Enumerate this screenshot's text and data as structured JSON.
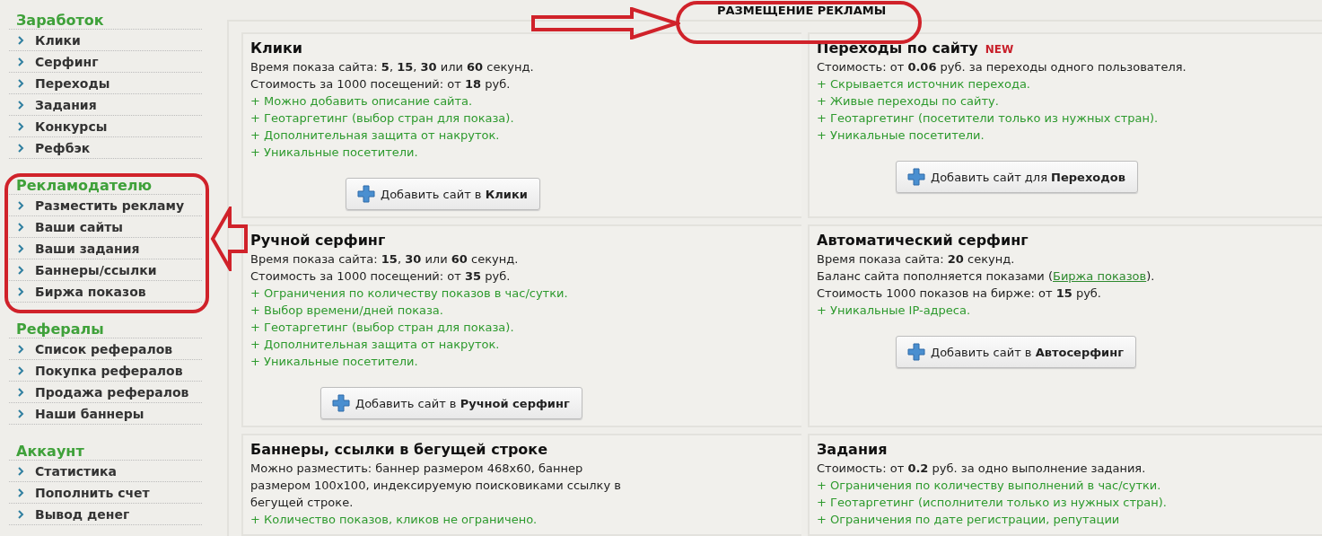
{
  "sidebar": {
    "sections": [
      {
        "heading": "Заработок",
        "items": [
          {
            "label": "Клики"
          },
          {
            "label": "Серфинг"
          },
          {
            "label": "Переходы"
          },
          {
            "label": "Задания"
          },
          {
            "label": "Конкурсы"
          },
          {
            "label": "Рефбэк"
          }
        ]
      },
      {
        "heading": "Рекламодателю",
        "items": [
          {
            "label": "Разместить рекламу"
          },
          {
            "label": "Ваши сайты"
          },
          {
            "label": "Ваши задания"
          },
          {
            "label": "Баннеры/ссылки"
          },
          {
            "label": "Биржа показов"
          }
        ]
      },
      {
        "heading": "Рефералы",
        "items": [
          {
            "label": "Список рефералов"
          },
          {
            "label": "Покупка рефералов"
          },
          {
            "label": "Продажа рефералов"
          },
          {
            "label": "Наши баннеры"
          }
        ]
      },
      {
        "heading": "Аккаунт",
        "items": [
          {
            "label": "Статистика"
          },
          {
            "label": "Пополнить счет"
          },
          {
            "label": "Вывод денег"
          }
        ]
      }
    ]
  },
  "page_title": "РАЗМЕЩЕНИЕ РЕКЛАМЫ",
  "cards": [
    {
      "title": "Клики",
      "lines": [
        {
          "kind": "info",
          "text": "Время показа сайта: **5**, **15**, **30** или **60** секунд."
        },
        {
          "kind": "info",
          "text": "Стоимость за 1000 посещений: от **18** руб."
        },
        {
          "kind": "plus",
          "text": "+ Можно добавить описание сайта."
        },
        {
          "kind": "plus",
          "text": "+ Геотаргетинг (выбор стран для показа)."
        },
        {
          "kind": "plus",
          "text": "+ Дополнительная защита от накруток."
        },
        {
          "kind": "plus",
          "text": "+ Уникальные посетители."
        }
      ],
      "button": "Добавить сайт в **Клики**"
    },
    {
      "title": "Переходы по сайту",
      "badge": "NEW",
      "lines": [
        {
          "kind": "info",
          "text": "Стоимость: от **0.06** руб. за переходы одного пользователя."
        },
        {
          "kind": "plus",
          "text": "+ Скрывается источник перехода."
        },
        {
          "kind": "plus",
          "text": "+ Живые переходы по сайту."
        },
        {
          "kind": "plus",
          "text": "+ Геотаргетинг (посетители только из нужных стран)."
        },
        {
          "kind": "plus",
          "text": "+ Уникальные посетители."
        }
      ],
      "button": "Добавить сайт для **Переходов**"
    },
    {
      "title": "Ручной серфинг",
      "lines": [
        {
          "kind": "info",
          "text": "Время показа сайта: **15**, **30** или **60** секунд."
        },
        {
          "kind": "info",
          "text": "Стоимость за 1000 посещений: от **35** руб."
        },
        {
          "kind": "plus",
          "text": "+ Ограничения по количеству показов в час/сутки."
        },
        {
          "kind": "plus",
          "text": "+ Выбор времени/дней показа."
        },
        {
          "kind": "plus",
          "text": "+ Геотаргетинг (выбор стран для показа)."
        },
        {
          "kind": "plus",
          "text": "+ Дополнительная защита от накруток."
        },
        {
          "kind": "plus",
          "text": "+ Уникальные посетители."
        }
      ],
      "button": "Добавить сайт в **Ручной серфинг**"
    },
    {
      "title": "Автоматический серфинг",
      "lines": [
        {
          "kind": "info",
          "text": "Время показа сайта: **20** секунд."
        },
        {
          "kind": "link",
          "text": "Баланс сайта пополняется показами (",
          "link": "Биржа показов",
          "after": ")."
        },
        {
          "kind": "info",
          "text": "Стоимость 1000 показов на бирже: от **15** руб."
        },
        {
          "kind": "plus",
          "text": "+ Уникальные IP-адреса."
        }
      ],
      "button": "Добавить сайт в **Автосерфинг**"
    },
    {
      "title": "Баннеры, ссылки в бегущей строке",
      "lines": [
        {
          "kind": "info",
          "text": "Можно разместить: баннер размером 468x60, баннер размером 100x100, индексируемую поисковиками ссылку в бегущей строке."
        },
        {
          "kind": "plus",
          "text": "+ Количество показов, кликов не ограничено."
        }
      ]
    },
    {
      "title": "Задания",
      "lines": [
        {
          "kind": "info",
          "text": "Стоимость: от **0.2** руб. за одно выполнение задания."
        },
        {
          "kind": "plus",
          "text": "+ Ограничения по количеству выполнений в час/сутки."
        },
        {
          "kind": "plus",
          "text": "+ Геотаргетинг (исполнители только из нужных стран)."
        },
        {
          "kind": "plus",
          "text": "+ Ограничения по дате регистрации, репутации"
        }
      ]
    }
  ]
}
